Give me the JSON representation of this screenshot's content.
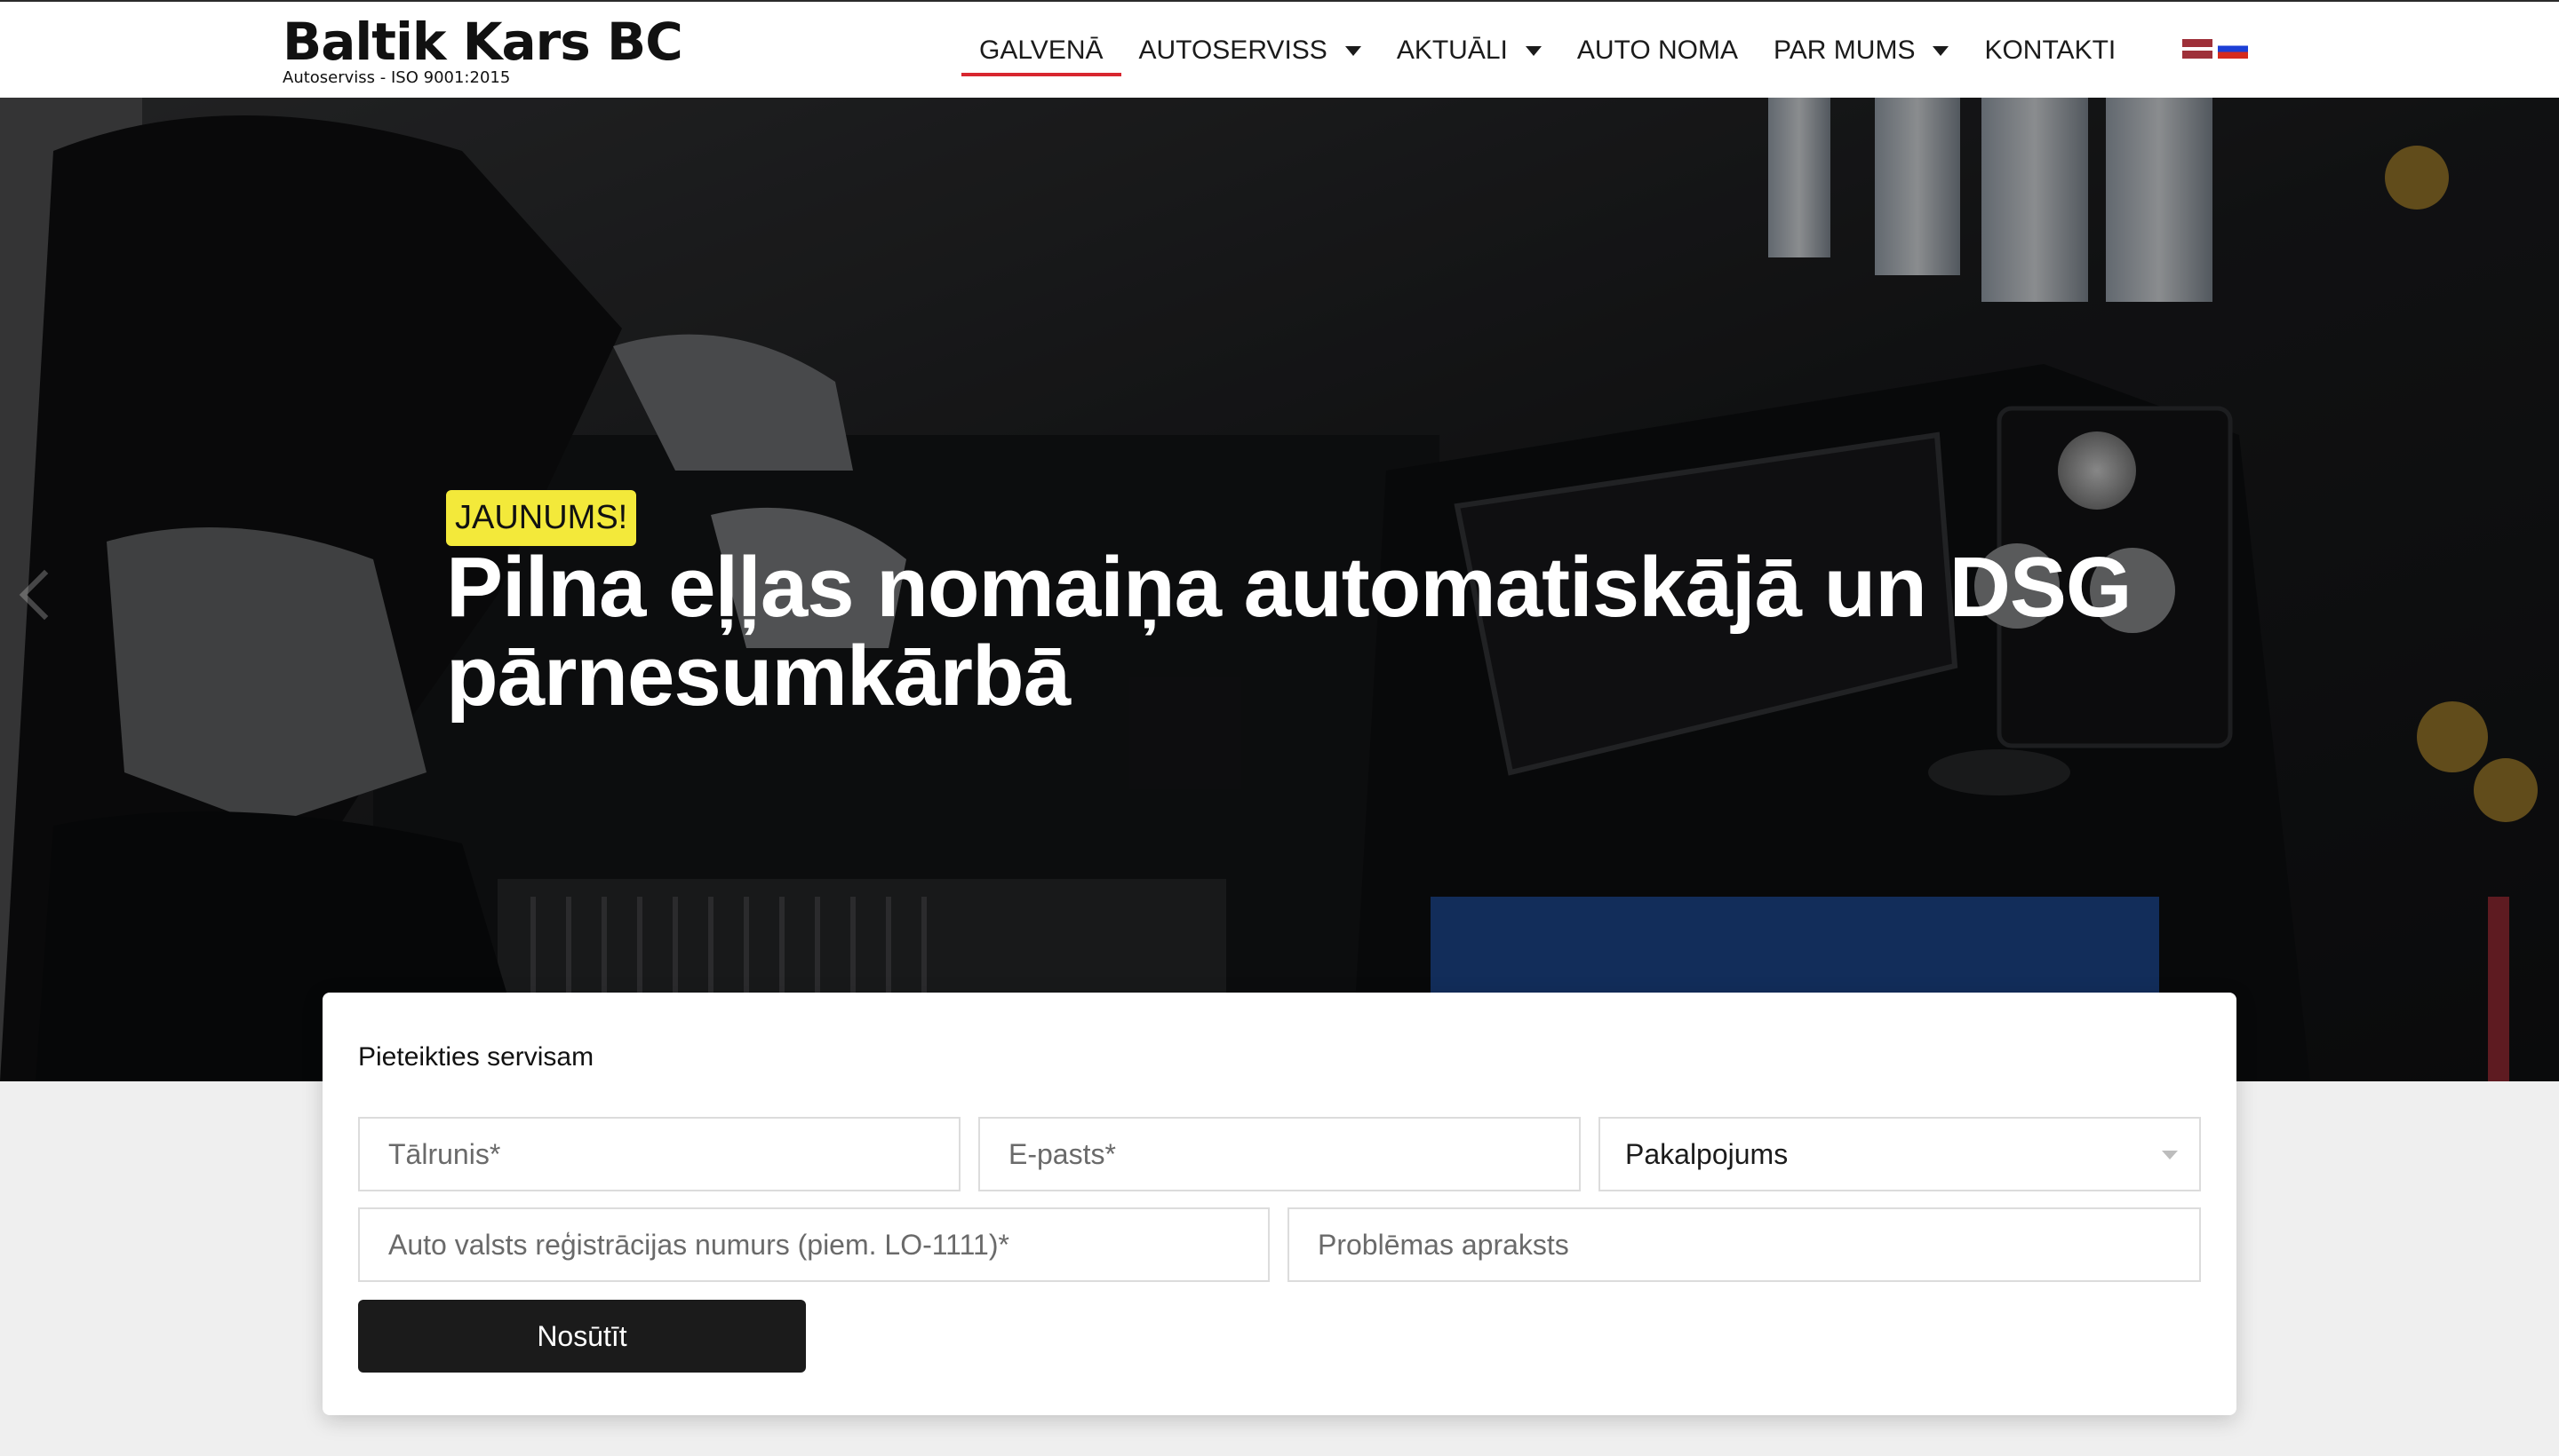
{
  "brand": {
    "name": "Baltik Kars BC",
    "tagline": "Autoserviss - ISO 9001:2015"
  },
  "nav": {
    "items": [
      {
        "label": "GALVENĀ",
        "active": true,
        "has_dropdown": false
      },
      {
        "label": "AUTOSERVISS",
        "active": false,
        "has_dropdown": true
      },
      {
        "label": "AKTUĀLI",
        "active": false,
        "has_dropdown": true
      },
      {
        "label": "AUTO NOMA",
        "active": false,
        "has_dropdown": false
      },
      {
        "label": "PAR MUMS",
        "active": false,
        "has_dropdown": true
      },
      {
        "label": "KONTAKTI",
        "active": false,
        "has_dropdown": false
      }
    ],
    "languages": [
      "lv-flag-icon",
      "ru-flag-icon"
    ],
    "active_color": "#d8262f"
  },
  "hero": {
    "badge": "JAUNUMS!",
    "badge_color": "#f3e93a",
    "title": "Pilna eļļas nomaiņa automatiskājā un DSG pārnesumkārbā"
  },
  "form": {
    "title": "Pieteikties servisam",
    "phone_placeholder": "Tālrunis*",
    "email_placeholder": "E-pasts*",
    "service_select_value": "Pakalpojums",
    "plate_placeholder": "Auto valsts reģistrācijas numurs (piem. LO-1111)*",
    "problem_placeholder": "Problēmas apraksts",
    "submit_label": "Nosūtīt"
  }
}
